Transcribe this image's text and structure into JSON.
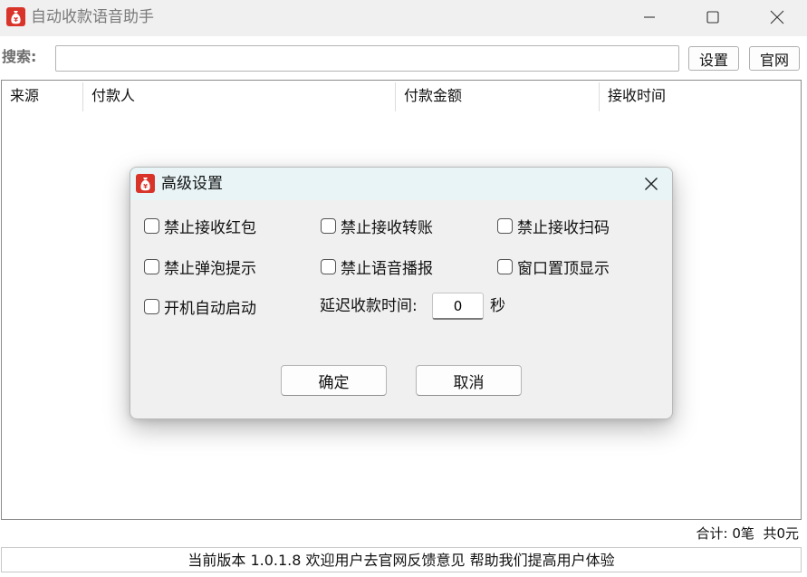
{
  "window": {
    "title": "自动收款语音助手",
    "minimize_icon": "minimize-icon",
    "maximize_icon": "maximize-icon",
    "close_icon": "close-icon"
  },
  "toolbar": {
    "search_label": "搜索:",
    "search_value": "",
    "search_placeholder": "",
    "settings_label": "设置",
    "website_label": "官网"
  },
  "table": {
    "columns": [
      "来源",
      "付款人",
      "付款金额",
      "接收时间"
    ],
    "rows": []
  },
  "summary": {
    "text": "合计: 0笔  共0元"
  },
  "statusbar": {
    "text": "当前版本 1.0.1.8 欢迎用户去官网反馈意见 帮助我们提高用户体验"
  },
  "dialog": {
    "title": "高级设置",
    "checkboxes": [
      {
        "label": "禁止接收红包",
        "checked": false
      },
      {
        "label": "禁止接收转账",
        "checked": false
      },
      {
        "label": "禁止接收扫码",
        "checked": false
      },
      {
        "label": "禁止弹泡提示",
        "checked": false
      },
      {
        "label": "禁止语音播报",
        "checked": false
      },
      {
        "label": "窗口置顶显示",
        "checked": false
      },
      {
        "label": "开机自动启动",
        "checked": false
      }
    ],
    "delay_label": "延迟收款时间:",
    "delay_value": "0",
    "delay_unit": "秒",
    "ok_label": "确定",
    "cancel_label": "取消"
  },
  "colors": {
    "accent_icon": "#d8342a",
    "dialog_title_bg": "#e8f4f6",
    "window_title_bg": "#f0f0f0"
  }
}
